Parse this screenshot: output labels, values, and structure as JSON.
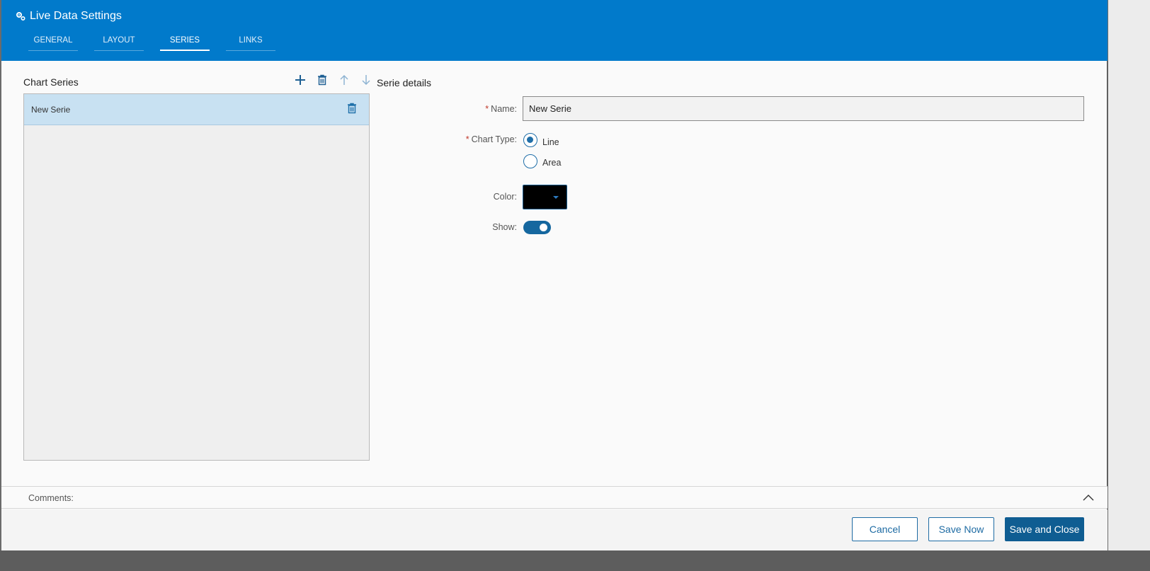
{
  "window": {
    "title": "Live Data Settings",
    "title_icon": "gear-icon"
  },
  "tabs": [
    {
      "label": "GENERAL",
      "active": false
    },
    {
      "label": "LAYOUT",
      "active": false
    },
    {
      "label": "SERIES",
      "active": true
    },
    {
      "label": "LINKS",
      "active": false
    }
  ],
  "series_panel": {
    "title": "Chart Series",
    "toolbar": [
      "plus-icon",
      "trash-icon",
      "arrow-up-icon",
      "arrow-down-icon"
    ],
    "items": [
      {
        "label": "New Serie",
        "selected": true
      }
    ]
  },
  "details": {
    "title": "Serie details",
    "name_label": "Name:",
    "name_value": "New Serie",
    "chart_type_label": "Chart Type:",
    "chart_type_options": [
      {
        "label": "Line",
        "checked": true
      },
      {
        "label": "Area",
        "checked": false
      }
    ],
    "color_label": "Color:",
    "color_value": "#000000",
    "show_label": "Show:",
    "show_on": true
  },
  "comments": {
    "label": "Comments:"
  },
  "footer": {
    "cancel_label": "Cancel",
    "save_now_label": "Save Now",
    "save_close_label": "Save and Close"
  },
  "colors": {
    "header_bg": "#017acb",
    "selected_row": "#c8e1f2",
    "primary_button": "#0f5d92",
    "accent": "#1f6ea8",
    "required": "#c0392b"
  }
}
